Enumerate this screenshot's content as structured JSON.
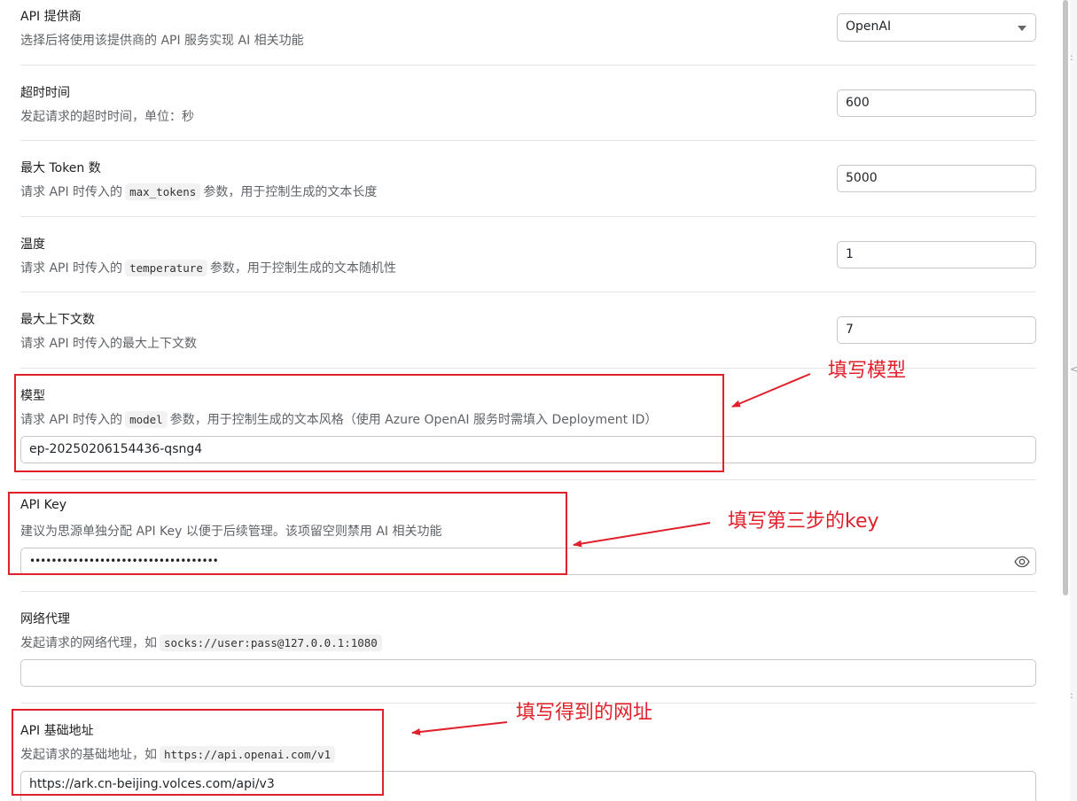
{
  "settings": {
    "provider": {
      "title": "API 提供商",
      "desc": "选择后将使用该提供商的 API 服务实现 AI 相关功能",
      "value": "OpenAI"
    },
    "timeout": {
      "title": "超时时间",
      "desc": "发起请求的超时时间，单位：秒",
      "value": "600"
    },
    "max_tokens": {
      "title": "最大 Token 数",
      "desc_pre": "请求 API 时传入的",
      "desc_code": "max_tokens",
      "desc_post": "参数，用于控制生成的文本长度",
      "value": "5000"
    },
    "temperature": {
      "title": "温度",
      "desc_pre": "请求 API 时传入的",
      "desc_code": "temperature",
      "desc_post": "参数，用于控制生成的文本随机性",
      "value": "1"
    },
    "max_contexts": {
      "title": "最大上下文数",
      "desc": "请求 API 时传入的最大上下文数",
      "value": "7"
    },
    "model": {
      "title": "模型",
      "desc_pre": "请求 API 时传入的",
      "desc_code": "model",
      "desc_post": "参数，用于控制生成的文本风格（使用 Azure OpenAI 服务时需填入 Deployment ID）",
      "value": "ep-20250206154436-qsng4"
    },
    "api_key": {
      "title": "API Key",
      "desc": "建议为思源单独分配 API Key 以便于后续管理。该项留空则禁用 AI 相关功能",
      "value": "•••••••••••••••••••••••••••••••••••"
    },
    "proxy": {
      "title": "网络代理",
      "desc_pre": "发起请求的网络代理，如",
      "desc_code": "socks://user:pass@127.0.0.1:1080",
      "value": ""
    },
    "base_url": {
      "title": "API 基础地址",
      "desc_pre": "发起请求的基础地址，如",
      "desc_code": "https://api.openai.com/v1",
      "value": "https://ark.cn-beijing.volces.com/api/v3"
    }
  },
  "annotations": {
    "model_note": "填写模型",
    "key_note": "填写第三步的key",
    "url_note": "填写得到的网址"
  },
  "colors": {
    "annotation": "#e0202a",
    "border": "#c8c8c8",
    "desc_text": "#5f6368"
  },
  "icons": {
    "select": "chevron-down-icon",
    "password_toggle": "eye-icon"
  }
}
